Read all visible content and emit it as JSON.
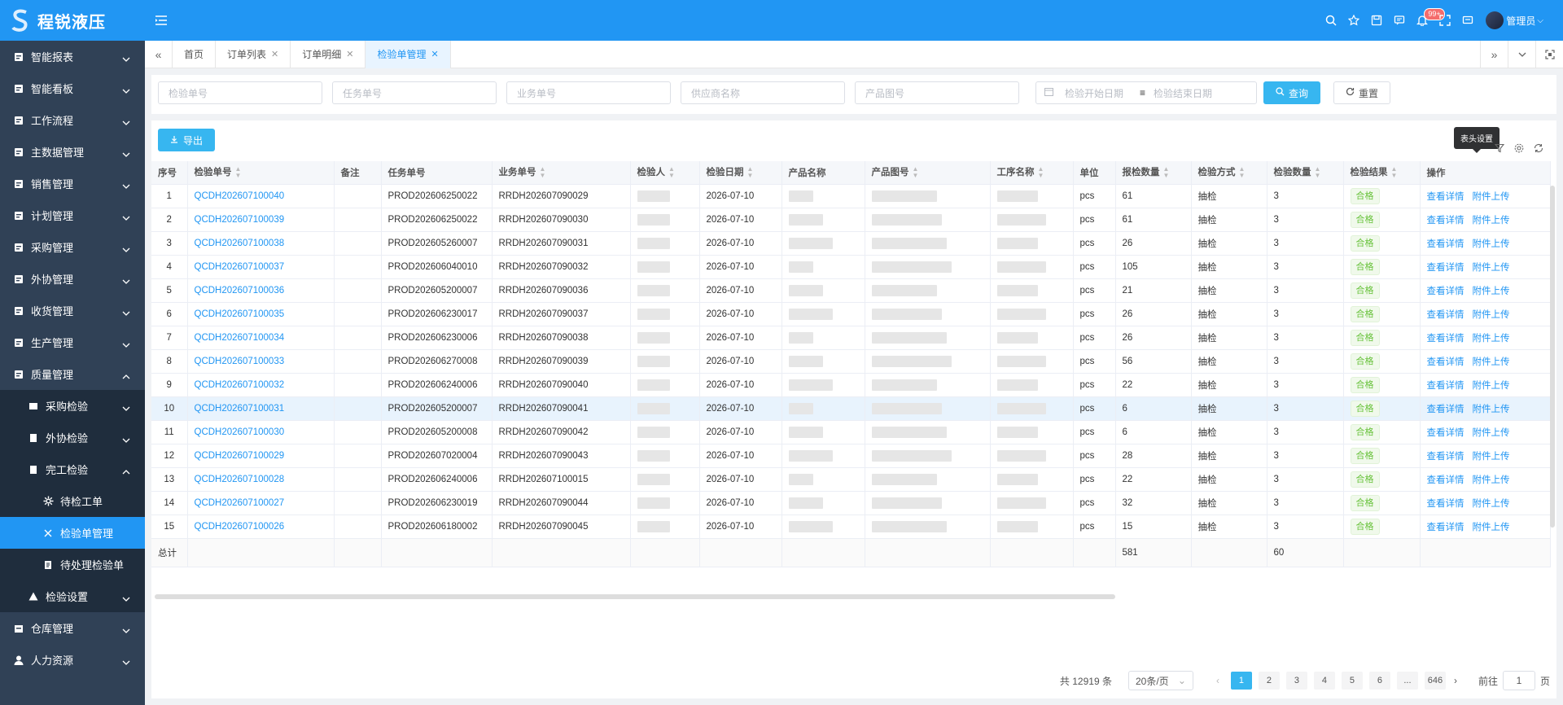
{
  "app": {
    "title": "程锐液压",
    "user": "管理员",
    "notification_badge": "99+"
  },
  "sidebar": {
    "items": [
      {
        "label": "智能报表",
        "icon": "report-icon"
      },
      {
        "label": "智能看板",
        "icon": "dashboard-icon"
      },
      {
        "label": "工作流程",
        "icon": "workflow-icon"
      },
      {
        "label": "主数据管理",
        "icon": "masterdata-icon"
      },
      {
        "label": "销售管理",
        "icon": "sales-icon"
      },
      {
        "label": "计划管理",
        "icon": "plan-icon"
      },
      {
        "label": "采购管理",
        "icon": "purchase-icon"
      },
      {
        "label": "外协管理",
        "icon": "outsource-icon"
      },
      {
        "label": "收货管理",
        "icon": "receive-icon"
      },
      {
        "label": "生产管理",
        "icon": "production-icon"
      },
      {
        "label": "质量管理",
        "icon": "quality-icon"
      }
    ],
    "quality_sub": [
      {
        "label": "采购检验"
      },
      {
        "label": "外协检验"
      },
      {
        "label": "完工检验"
      }
    ],
    "finish_sub": [
      {
        "label": "待检工单"
      },
      {
        "label": "检验单管理"
      },
      {
        "label": "待处理检验单"
      }
    ],
    "inspect_settings": "检验设置",
    "bottom_items": [
      {
        "label": "仓库管理"
      },
      {
        "label": "人力资源"
      }
    ]
  },
  "tags": [
    {
      "label": "首页",
      "closable": false
    },
    {
      "label": "订单列表",
      "closable": true
    },
    {
      "label": "订单明细",
      "closable": true
    },
    {
      "label": "检验单管理",
      "closable": true,
      "active": true
    }
  ],
  "filters": {
    "inspect_no": "检验单号",
    "task_no": "任务单号",
    "business_no": "业务单号",
    "supplier": "供应商名称",
    "drawing_no": "产品图号",
    "start_date": "检验开始日期",
    "end_date": "检验结束日期",
    "search": "查询",
    "reset": "重置"
  },
  "toolbar": {
    "export": "导出",
    "tooltip": "表头设置"
  },
  "table": {
    "headers": [
      "序号",
      "检验单号",
      "备注",
      "任务单号",
      "业务单号",
      "检验人",
      "检验日期",
      "产品名称",
      "产品图号",
      "工序名称",
      "单位",
      "报检数量",
      "检验方式",
      "检验数量",
      "检验结果",
      "操作"
    ],
    "rows": [
      {
        "idx": "1",
        "no": "QCDH202607100040",
        "task": "PROD202606250022",
        "biz": "RRDH202607090029",
        "date": "2026-07-10",
        "unit": "pcs",
        "qty": "61",
        "method": "抽检",
        "inspected": "3",
        "result": "合格"
      },
      {
        "idx": "2",
        "no": "QCDH202607100039",
        "task": "PROD202606250022",
        "biz": "RRDH202607090030",
        "date": "2026-07-10",
        "unit": "pcs",
        "qty": "61",
        "method": "抽检",
        "inspected": "3",
        "result": "合格"
      },
      {
        "idx": "3",
        "no": "QCDH202607100038",
        "task": "PROD202605260007",
        "biz": "RRDH202607090031",
        "date": "2026-07-10",
        "unit": "pcs",
        "qty": "26",
        "method": "抽检",
        "inspected": "3",
        "result": "合格"
      },
      {
        "idx": "4",
        "no": "QCDH202607100037",
        "task": "PROD202606040010",
        "biz": "RRDH202607090032",
        "date": "2026-07-10",
        "unit": "pcs",
        "qty": "105",
        "method": "抽检",
        "inspected": "3",
        "result": "合格"
      },
      {
        "idx": "5",
        "no": "QCDH202607100036",
        "task": "PROD202605200007",
        "biz": "RRDH202607090036",
        "date": "2026-07-10",
        "unit": "pcs",
        "qty": "21",
        "method": "抽检",
        "inspected": "3",
        "result": "合格"
      },
      {
        "idx": "6",
        "no": "QCDH202607100035",
        "task": "PROD202606230017",
        "biz": "RRDH202607090037",
        "date": "2026-07-10",
        "unit": "pcs",
        "qty": "26",
        "method": "抽检",
        "inspected": "3",
        "result": "合格"
      },
      {
        "idx": "7",
        "no": "QCDH202607100034",
        "task": "PROD202606230006",
        "biz": "RRDH202607090038",
        "date": "2026-07-10",
        "unit": "pcs",
        "qty": "26",
        "method": "抽检",
        "inspected": "3",
        "result": "合格"
      },
      {
        "idx": "8",
        "no": "QCDH202607100033",
        "task": "PROD202606270008",
        "biz": "RRDH202607090039",
        "date": "2026-07-10",
        "unit": "pcs",
        "qty": "56",
        "method": "抽检",
        "inspected": "3",
        "result": "合格"
      },
      {
        "idx": "9",
        "no": "QCDH202607100032",
        "task": "PROD202606240006",
        "biz": "RRDH202607090040",
        "date": "2026-07-10",
        "unit": "pcs",
        "qty": "22",
        "method": "抽检",
        "inspected": "3",
        "result": "合格"
      },
      {
        "idx": "10",
        "no": "QCDH202607100031",
        "task": "PROD202605200007",
        "biz": "RRDH202607090041",
        "date": "2026-07-10",
        "unit": "pcs",
        "qty": "6",
        "method": "抽检",
        "inspected": "3",
        "result": "合格"
      },
      {
        "idx": "11",
        "no": "QCDH202607100030",
        "task": "PROD202605200008",
        "biz": "RRDH202607090042",
        "date": "2026-07-10",
        "unit": "pcs",
        "qty": "6",
        "method": "抽检",
        "inspected": "3",
        "result": "合格"
      },
      {
        "idx": "12",
        "no": "QCDH202607100029",
        "task": "PROD202607020004",
        "biz": "RRDH202607090043",
        "date": "2026-07-10",
        "unit": "pcs",
        "qty": "28",
        "method": "抽检",
        "inspected": "3",
        "result": "合格"
      },
      {
        "idx": "13",
        "no": "QCDH202607100028",
        "task": "PROD202606240006",
        "biz": "RRDH202607100015",
        "date": "2026-07-10",
        "unit": "pcs",
        "qty": "22",
        "method": "抽检",
        "inspected": "3",
        "result": "合格"
      },
      {
        "idx": "14",
        "no": "QCDH202607100027",
        "task": "PROD202606230019",
        "biz": "RRDH202607090044",
        "date": "2026-07-10",
        "unit": "pcs",
        "qty": "32",
        "method": "抽检",
        "inspected": "3",
        "result": "合格"
      },
      {
        "idx": "15",
        "no": "QCDH202607100026",
        "task": "PROD202606180002",
        "biz": "RRDH202607090045",
        "date": "2026-07-10",
        "unit": "pcs",
        "qty": "15",
        "method": "抽检",
        "inspected": "3",
        "result": "合格"
      }
    ],
    "op_view": "查看详情",
    "op_upload": "附件上传",
    "total_label": "总计",
    "total_qty": "581",
    "total_inspected": "60"
  },
  "pagination": {
    "total": "共 12919 条",
    "page_size": "20条/页",
    "pages": [
      "1",
      "2",
      "3",
      "4",
      "5",
      "6",
      "...",
      "646"
    ],
    "current": "1",
    "goto_label": "前往",
    "goto_value": "1",
    "page_unit": "页"
  }
}
